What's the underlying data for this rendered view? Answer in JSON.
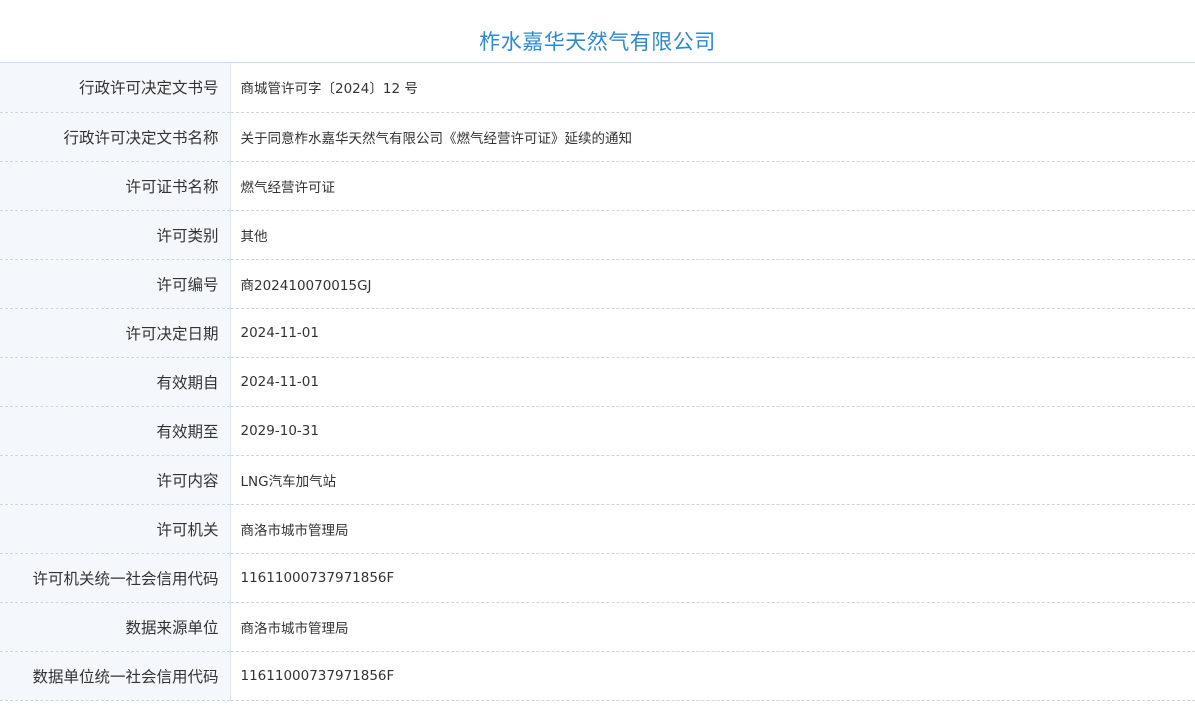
{
  "title": "柞水嘉华天然气有限公司",
  "rows": [
    {
      "label": "行政许可决定文书号",
      "value": "商城管许可字〔2024〕12 号"
    },
    {
      "label": "行政许可决定文书名称",
      "value": "关于同意柞水嘉华天然气有限公司《燃气经营许可证》延续的通知"
    },
    {
      "label": "许可证书名称",
      "value": "燃气经营许可证"
    },
    {
      "label": "许可类别",
      "value": "其他"
    },
    {
      "label": "许可编号",
      "value": "商202410070015GJ"
    },
    {
      "label": "许可决定日期",
      "value": "2024-11-01"
    },
    {
      "label": "有效期自",
      "value": "2024-11-01"
    },
    {
      "label": "有效期至",
      "value": "2029-10-31"
    },
    {
      "label": "许可内容",
      "value": "LNG汽车加气站"
    },
    {
      "label": "许可机关",
      "value": "商洛市城市管理局"
    },
    {
      "label": "许可机关统一社会信用代码",
      "value": "11611000737971856F"
    },
    {
      "label": "数据来源单位",
      "value": "商洛市城市管理局"
    },
    {
      "label": "数据单位统一社会信用代码",
      "value": "11611000737971856F"
    }
  ]
}
